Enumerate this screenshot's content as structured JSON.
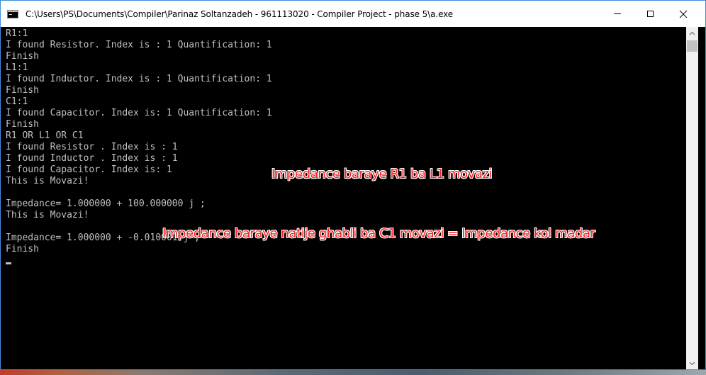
{
  "window": {
    "title": "C:\\Users\\PS\\Documents\\Compiler\\Parinaz Soltanzadeh - 961113020 - Compiler Project - phase 5\\a.exe",
    "controls": {
      "minimize_icon": "minimize-icon",
      "maximize_icon": "maximize-icon",
      "close_icon": "close-icon"
    }
  },
  "console": {
    "lines": [
      "R1:1",
      "I found Resistor. Index is : 1 Quantification: 1",
      "Finish",
      "L1:1",
      "I found Inductor. Index is : 1 Quantification: 1",
      "Finish",
      "C1:1",
      "I found Capacitor. Index is: 1 Quantification: 1",
      "Finish",
      "R1 OR L1 OR C1",
      "I found Resistor . Index is : 1",
      "I found Inductor . Index is : 1",
      "I found Capacitor. Index is: 1",
      "This is Movazi!",
      "",
      "Impedance= 1.000000 + 100.000000 j ;",
      "This is Movazi!",
      "",
      "Impedance= 1.000000 + -0.010001 j ;",
      "Finish"
    ],
    "text_color": "#c0c0c0",
    "background": "#000000"
  },
  "annotations": {
    "first": "Impedance baraye R1 ba L1 movazi",
    "second": "Impedance baraye natije ghabli ba C1 movazi = Impedance kol madar",
    "color": "#ff2020"
  }
}
